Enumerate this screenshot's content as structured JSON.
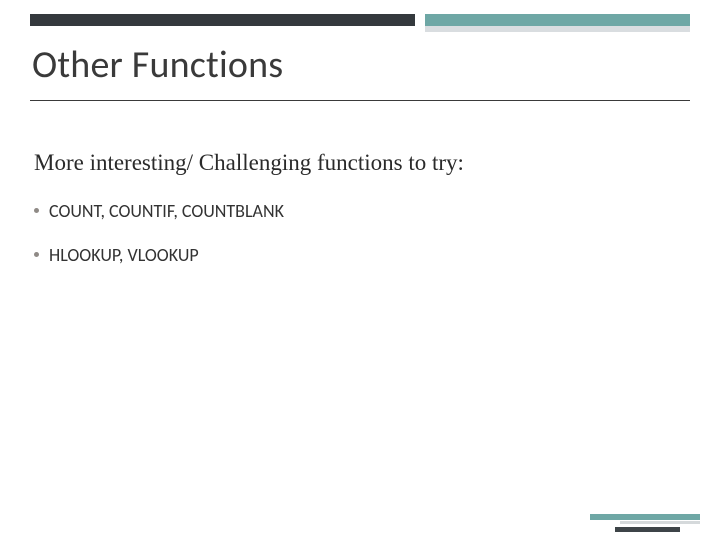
{
  "title": "Other Functions",
  "lead": "More interesting/ Challenging functions to try:",
  "bullets": [
    "COUNT, COUNTIF, COUNTBLANK",
    "HLOOKUP, VLOOKUP"
  ]
}
